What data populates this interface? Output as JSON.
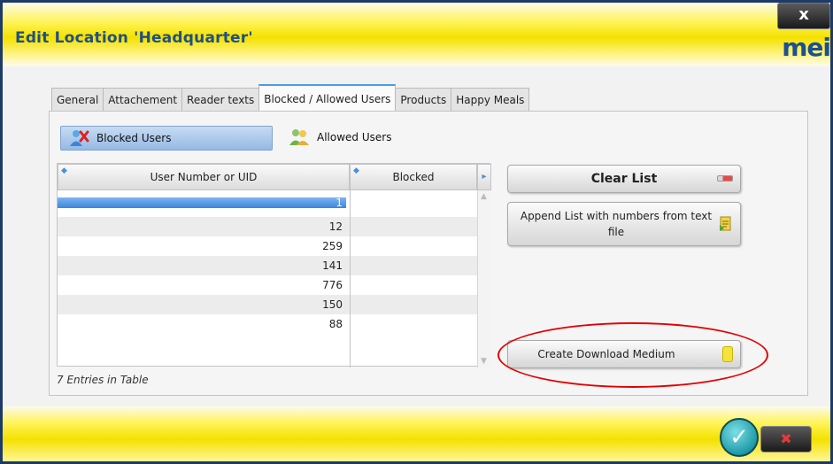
{
  "window": {
    "title": "Edit Location 'Headquarter'",
    "close_glyph": "x",
    "logo_text": "mei"
  },
  "tabs": [
    {
      "label": "General"
    },
    {
      "label": "Attachement"
    },
    {
      "label": "Reader texts"
    },
    {
      "label": "Blocked / Allowed Users",
      "active": true
    },
    {
      "label": "Products"
    },
    {
      "label": "Happy Meals"
    }
  ],
  "mode": {
    "blocked_label": "Blocked Users",
    "allowed_label": "Allowed Users",
    "selected": "Blocked Users"
  },
  "table": {
    "headers": [
      "User Number or UID",
      "Blocked"
    ],
    "rows": [
      {
        "uid": "1",
        "blocked": ""
      },
      {
        "uid": "12",
        "blocked": ""
      },
      {
        "uid": "259",
        "blocked": ""
      },
      {
        "uid": "141",
        "blocked": ""
      },
      {
        "uid": "776",
        "blocked": ""
      },
      {
        "uid": "150",
        "blocked": ""
      },
      {
        "uid": "88",
        "blocked": ""
      }
    ],
    "selected_row": 0,
    "entries_label": "7 Entries in Table"
  },
  "buttons": {
    "clear_list": "Clear List",
    "append_list": "Append List with numbers from text file",
    "create_download": "Create Download Medium"
  },
  "footer": {
    "ok_glyph": "✓",
    "cancel_glyph": "✖"
  },
  "colors": {
    "title_text": "#1f4f86",
    "highlight_ellipse": "#e30000",
    "selection": "#3b86dd",
    "header_band": "#f4e100"
  }
}
